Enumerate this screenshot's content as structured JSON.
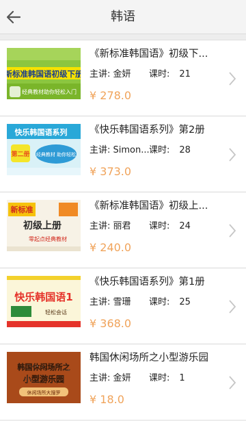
{
  "header": {
    "title": "韩语",
    "back_icon": "arrow-left-icon"
  },
  "courses": [
    {
      "title": "《新标准韩国语》初级下...",
      "teacher": "主讲: 金妍",
      "lessons_label": "课时:",
      "lessons": "21",
      "price": "¥ 278.0",
      "cover_text": [
        "新标准韩国语初级下册",
        "经典教材助你轻松入门"
      ]
    },
    {
      "title": "《快乐韩国语系列》第2册",
      "teacher": "主讲: Simon...",
      "lessons_label": "课时:",
      "lessons": "28",
      "price": "¥ 373.0",
      "cover_text": [
        "快乐韩国语系列",
        "第二册",
        "经典教材 助你轻松"
      ]
    },
    {
      "title": "《新标准韩国语》初级上...",
      "teacher": "主讲: 丽君",
      "lessons_label": "课时:",
      "lessons": "24",
      "price": "¥ 240.0",
      "cover_text": [
        "新标准",
        "初级上册",
        "零起点经典教材"
      ]
    },
    {
      "title": "《快乐韩国语系列》第1册",
      "teacher": "主讲: 雪珊",
      "lessons_label": "课时:",
      "lessons": "25",
      "price": "¥ 368.0",
      "cover_text": [
        "快乐韩国语1",
        "轻松会话"
      ]
    },
    {
      "title": "韩国休闲场所之小型游乐园",
      "teacher": "主讲: 金妍",
      "lessons_label": "课时:",
      "lessons": "1",
      "price": "¥ 18.0",
      "cover_text": [
        "韩国休闲场所之",
        "小型游乐园",
        "休闲场所大搜罗"
      ]
    }
  ],
  "colors": {
    "price": "#f0a35a",
    "chevron": "#c6c6c6"
  }
}
